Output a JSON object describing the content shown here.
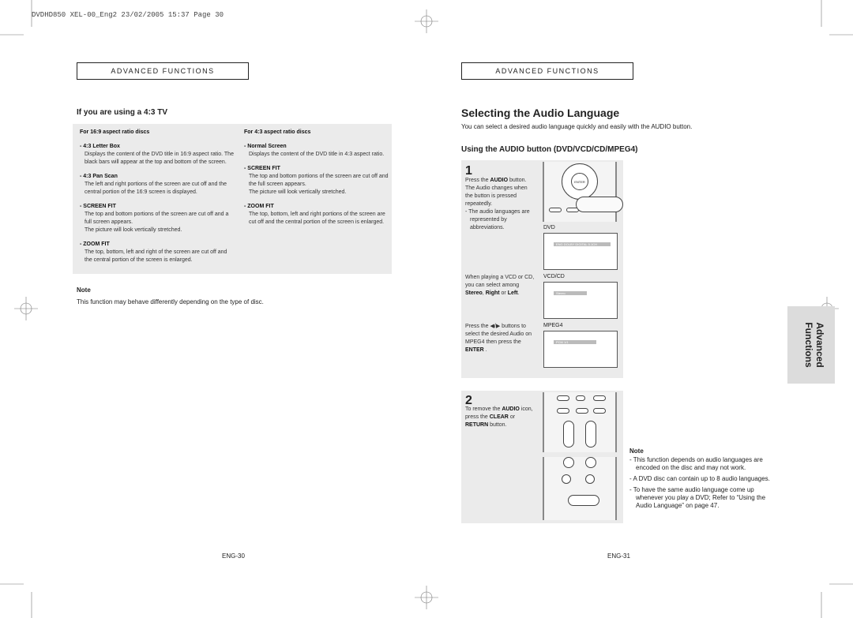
{
  "slug": "DVDHD850 XEL-00_Eng2  23/02/2005  15:37  Page 30",
  "left": {
    "header": "Advanced Functions",
    "heading": "If you are using a 4:3 TV",
    "col1": {
      "title": "For 16:9 aspect ratio discs",
      "items": [
        {
          "name": "- 4:3 Letter Box",
          "text": "Displays the content of the DVD title in 16:9 aspect ratio. The black bars will appear at the top and bottom of the screen."
        },
        {
          "name": "- 4:3 Pan Scan",
          "text": "The left and right portions of the screen are cut off and the central portion of the 16:9 screen is displayed."
        },
        {
          "name": "- SCREEN FIT",
          "text": "The top and bottom portions of the screen are cut off and a full screen appears.",
          "text2": "The picture will look vertically stretched."
        },
        {
          "name": "- ZOOM FIT",
          "text": "The top, bottom, left and right of the screen are cut off and the central portion of the screen is enlarged."
        }
      ]
    },
    "col2": {
      "title": "For 4:3 aspect ratio discs",
      "items": [
        {
          "name": "- Normal Screen",
          "text": "Displays the content of the DVD title in 4:3 aspect ratio."
        },
        {
          "name": "- SCREEN FIT",
          "text": "The top and bottom portions of the screen are cut off and the full screen appears.",
          "text2": "The picture will look vertically stretched."
        },
        {
          "name": "- ZOOM FIT",
          "text": "The top, bottom, left and right portions of the screen are cut off and the central portion of the screen is enlarged."
        }
      ]
    },
    "note_title": "Note",
    "note_text": "This function may behave differently depending on the type of disc.",
    "page": "ENG-30"
  },
  "right": {
    "header": "Advanced Functions",
    "title": "Selecting the Audio Language",
    "intro": "You can select a desired audio language quickly and easily with the AUDIO button.",
    "subheading": "Using the AUDIO button (DVD/VCD/CD/MPEG4)",
    "step1": {
      "num": "1",
      "l1a": "Press the ",
      "l1b": "AUDIO",
      "l1c": " button. The Audio changes when the button is pressed repeatedly.",
      "l2": "- The audio languages are represented by abbreviations.",
      "vcd_a": "When playing a VCD or CD, you can select among ",
      "vcd_b": "Stereo",
      "vcd_c": ", ",
      "vcd_d": "Right",
      "vcd_e": " or ",
      "vcd_f": "Left",
      "vcd_g": ".",
      "mp_a": "Press the ◀/▶ buttons to select the desired Audio on MPEG4 then press the ",
      "mp_b": "ENTER",
      "mp_c": " .",
      "dvd_label": "DVD",
      "vcd_label": "VCD/CD",
      "mpeg_label": "MPEG4",
      "dvd_osd": "ENG DOLBY DIGITAL 5.1CH",
      "vcd_osd": "Stereo",
      "mpeg_osd": "PCM 1/1"
    },
    "step2": {
      "num": "2",
      "a": "To remove the ",
      "b": "AUDIO",
      "c": " icon, press the ",
      "d": "CLEAR",
      "e": " or ",
      "f": "RETURN",
      "g": " button."
    },
    "note_title": "Note",
    "notes": [
      "- This function depends on audio languages are encoded on the disc and may not work.",
      "- A DVD disc can contain up to 8 audio languages.",
      "- To have the same audio language come up whenever you play a DVD; Refer to “Using the Audio Language” on page 47."
    ],
    "tab": "Advanced Functions",
    "page": "ENG-31"
  }
}
